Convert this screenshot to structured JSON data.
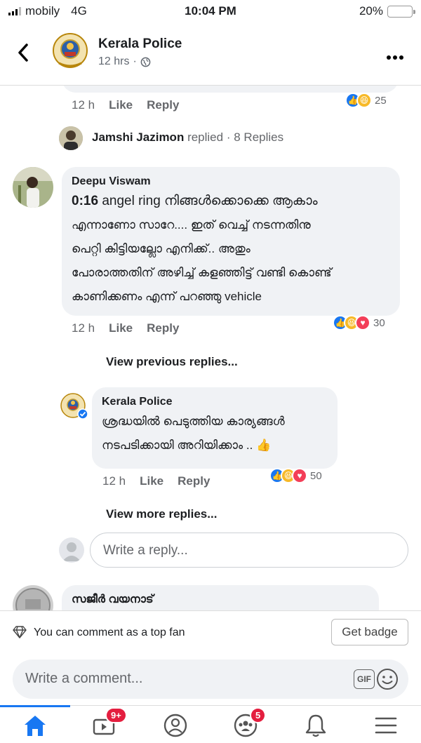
{
  "status_bar": {
    "carrier": "mobily",
    "network": "4G",
    "time": "10:04 PM",
    "battery": "20%"
  },
  "header": {
    "page_name": "Kerala Police",
    "time_ago": "12 hrs",
    "dot": "·"
  },
  "comments": {
    "first": {
      "time": "12 h",
      "like": "Like",
      "reply": "Reply",
      "reactions": "25"
    },
    "jamshi": {
      "name": "Jamshi Jazimon",
      "replied": "replied",
      "dot": "·",
      "replies": "8 Replies"
    },
    "deepu": {
      "name": "Deepu Viswam",
      "lines": [
        "0:16 angel ring നിങ്ങൾക്കൊക്കെ ആകാം",
        "എന്നാണോ സാറേ.... ഇത് വെച്ച് നടന്നതിനു",
        "പെറ്റി കിട്ടിയല്ലോ എനിക്ക്.. അതും",
        "പോരാത്തതിന് അഴിച്ച് കളഞ്ഞിട്ട് വണ്ടി കൊണ്ട്",
        "കാണിക്കണം എന്ന് പറഞ്ഞു vehicle"
      ],
      "time": "12 h",
      "like": "Like",
      "reply": "Reply",
      "reactions": "30"
    },
    "view_previous": "View previous replies...",
    "kp_reply": {
      "name": "Kerala Police",
      "lines": [
        "ശ്രദ്ധയിൽ പെടുത്തിയ കാര്യങ്ങൾ",
        "നടപടിക്കായി അറിയിക്കാം .."
      ],
      "time": "12 h",
      "like": "Like",
      "reply": "Reply",
      "reactions": "50"
    },
    "view_more": "View more replies...",
    "write_reply_placeholder": "Write a reply...",
    "next_author": "സജീർ വയനാട്"
  },
  "top_fan": {
    "text": "You can comment as a top fan",
    "button": "Get badge"
  },
  "composer": {
    "placeholder": "Write a comment...",
    "gif": "GIF"
  },
  "nav": {
    "video_badge": "9+",
    "groups_badge": "5"
  },
  "colors": {
    "accent": "#1877f2",
    "badge": "#e41e3f",
    "bubble": "#f0f2f5"
  }
}
